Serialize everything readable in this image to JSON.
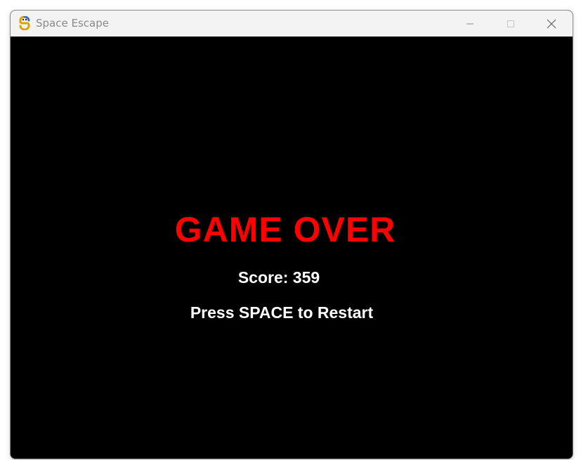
{
  "window": {
    "title": "Space Escape",
    "app_icon": "pygame-snake-icon",
    "controls": {
      "minimize_icon": "minimize-icon",
      "maximize_icon": "maximize-icon",
      "close_icon": "close-icon"
    }
  },
  "game": {
    "background_color": "#000000",
    "game_over_text": "GAME OVER",
    "game_over_color": "#ff0000",
    "score_text": "Score: 359",
    "score_value": 359,
    "restart_text": "Press SPACE to Restart",
    "text_color": "#ffffff"
  }
}
